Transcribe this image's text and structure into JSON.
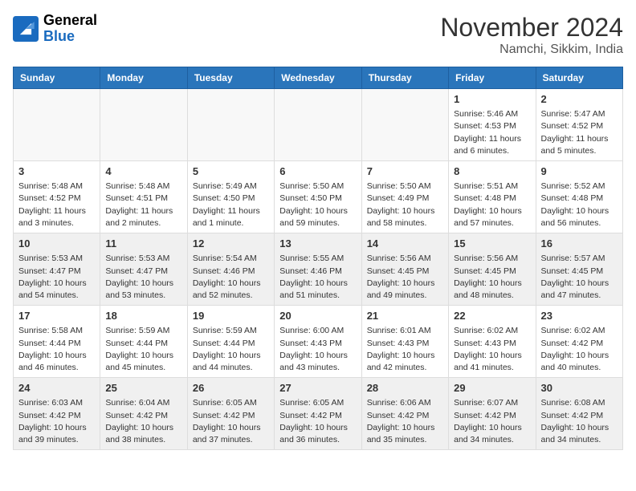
{
  "header": {
    "logo_line1": "General",
    "logo_line2": "Blue",
    "month": "November 2024",
    "location": "Namchi, Sikkim, India"
  },
  "weekdays": [
    "Sunday",
    "Monday",
    "Tuesday",
    "Wednesday",
    "Thursday",
    "Friday",
    "Saturday"
  ],
  "weeks": [
    [
      {
        "day": "",
        "empty": true
      },
      {
        "day": "",
        "empty": true
      },
      {
        "day": "",
        "empty": true
      },
      {
        "day": "",
        "empty": true
      },
      {
        "day": "",
        "empty": true
      },
      {
        "day": "1",
        "info": "Sunrise: 5:46 AM\nSunset: 4:53 PM\nDaylight: 11 hours\nand 6 minutes."
      },
      {
        "day": "2",
        "info": "Sunrise: 5:47 AM\nSunset: 4:52 PM\nDaylight: 11 hours\nand 5 minutes."
      }
    ],
    [
      {
        "day": "3",
        "info": "Sunrise: 5:48 AM\nSunset: 4:52 PM\nDaylight: 11 hours\nand 3 minutes."
      },
      {
        "day": "4",
        "info": "Sunrise: 5:48 AM\nSunset: 4:51 PM\nDaylight: 11 hours\nand 2 minutes."
      },
      {
        "day": "5",
        "info": "Sunrise: 5:49 AM\nSunset: 4:50 PM\nDaylight: 11 hours\nand 1 minute."
      },
      {
        "day": "6",
        "info": "Sunrise: 5:50 AM\nSunset: 4:50 PM\nDaylight: 10 hours\nand 59 minutes."
      },
      {
        "day": "7",
        "info": "Sunrise: 5:50 AM\nSunset: 4:49 PM\nDaylight: 10 hours\nand 58 minutes."
      },
      {
        "day": "8",
        "info": "Sunrise: 5:51 AM\nSunset: 4:48 PM\nDaylight: 10 hours\nand 57 minutes."
      },
      {
        "day": "9",
        "info": "Sunrise: 5:52 AM\nSunset: 4:48 PM\nDaylight: 10 hours\nand 56 minutes."
      }
    ],
    [
      {
        "day": "10",
        "info": "Sunrise: 5:53 AM\nSunset: 4:47 PM\nDaylight: 10 hours\nand 54 minutes.",
        "shaded": true
      },
      {
        "day": "11",
        "info": "Sunrise: 5:53 AM\nSunset: 4:47 PM\nDaylight: 10 hours\nand 53 minutes.",
        "shaded": true
      },
      {
        "day": "12",
        "info": "Sunrise: 5:54 AM\nSunset: 4:46 PM\nDaylight: 10 hours\nand 52 minutes.",
        "shaded": true
      },
      {
        "day": "13",
        "info": "Sunrise: 5:55 AM\nSunset: 4:46 PM\nDaylight: 10 hours\nand 51 minutes.",
        "shaded": true
      },
      {
        "day": "14",
        "info": "Sunrise: 5:56 AM\nSunset: 4:45 PM\nDaylight: 10 hours\nand 49 minutes.",
        "shaded": true
      },
      {
        "day": "15",
        "info": "Sunrise: 5:56 AM\nSunset: 4:45 PM\nDaylight: 10 hours\nand 48 minutes.",
        "shaded": true
      },
      {
        "day": "16",
        "info": "Sunrise: 5:57 AM\nSunset: 4:45 PM\nDaylight: 10 hours\nand 47 minutes.",
        "shaded": true
      }
    ],
    [
      {
        "day": "17",
        "info": "Sunrise: 5:58 AM\nSunset: 4:44 PM\nDaylight: 10 hours\nand 46 minutes."
      },
      {
        "day": "18",
        "info": "Sunrise: 5:59 AM\nSunset: 4:44 PM\nDaylight: 10 hours\nand 45 minutes."
      },
      {
        "day": "19",
        "info": "Sunrise: 5:59 AM\nSunset: 4:44 PM\nDaylight: 10 hours\nand 44 minutes."
      },
      {
        "day": "20",
        "info": "Sunrise: 6:00 AM\nSunset: 4:43 PM\nDaylight: 10 hours\nand 43 minutes."
      },
      {
        "day": "21",
        "info": "Sunrise: 6:01 AM\nSunset: 4:43 PM\nDaylight: 10 hours\nand 42 minutes."
      },
      {
        "day": "22",
        "info": "Sunrise: 6:02 AM\nSunset: 4:43 PM\nDaylight: 10 hours\nand 41 minutes."
      },
      {
        "day": "23",
        "info": "Sunrise: 6:02 AM\nSunset: 4:42 PM\nDaylight: 10 hours\nand 40 minutes."
      }
    ],
    [
      {
        "day": "24",
        "info": "Sunrise: 6:03 AM\nSunset: 4:42 PM\nDaylight: 10 hours\nand 39 minutes.",
        "shaded": true
      },
      {
        "day": "25",
        "info": "Sunrise: 6:04 AM\nSunset: 4:42 PM\nDaylight: 10 hours\nand 38 minutes.",
        "shaded": true
      },
      {
        "day": "26",
        "info": "Sunrise: 6:05 AM\nSunset: 4:42 PM\nDaylight: 10 hours\nand 37 minutes.",
        "shaded": true
      },
      {
        "day": "27",
        "info": "Sunrise: 6:05 AM\nSunset: 4:42 PM\nDaylight: 10 hours\nand 36 minutes.",
        "shaded": true
      },
      {
        "day": "28",
        "info": "Sunrise: 6:06 AM\nSunset: 4:42 PM\nDaylight: 10 hours\nand 35 minutes.",
        "shaded": true
      },
      {
        "day": "29",
        "info": "Sunrise: 6:07 AM\nSunset: 4:42 PM\nDaylight: 10 hours\nand 34 minutes.",
        "shaded": true
      },
      {
        "day": "30",
        "info": "Sunrise: 6:08 AM\nSunset: 4:42 PM\nDaylight: 10 hours\nand 34 minutes.",
        "shaded": true
      }
    ]
  ]
}
